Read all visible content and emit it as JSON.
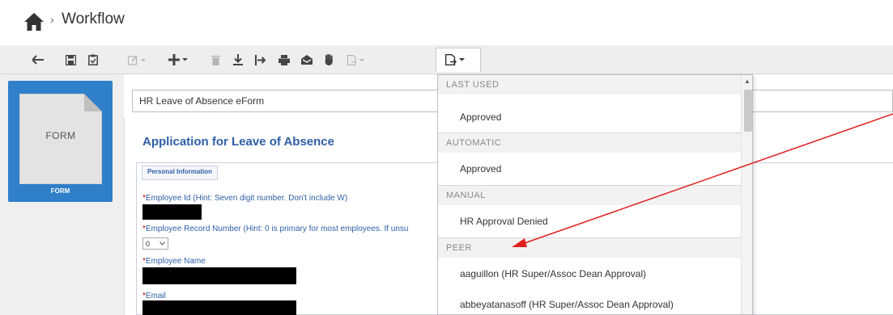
{
  "header": {
    "separator": "›",
    "title": "Workflow"
  },
  "form": {
    "title_value": "HR Leave of Absence eForm",
    "app_title": "Application for Leave of Absence",
    "section_legend": "Personal Information",
    "fields": {
      "employee_id_label": "Employee Id (Hint: Seven digit number. Don't include W)",
      "record_number_label": "Employee Record Number (Hint: 0 is primary for most employees. If unsu",
      "record_number_value": "0",
      "employee_name_label": "Employee Name",
      "email_label": "Email",
      "required_mark": "*"
    }
  },
  "thumbnail": {
    "doc_label": "FORM",
    "caption": "FORM"
  },
  "dropdown": {
    "sections": [
      {
        "header": "LAST USED",
        "items": [
          "Approved"
        ]
      },
      {
        "header": "AUTOMATIC",
        "items": [
          "Approved"
        ]
      },
      {
        "header": "MANUAL",
        "items": [
          "HR Approval Denied"
        ]
      },
      {
        "header": "PEER",
        "items": [
          "aaguillon (HR Super/Assoc Dean Approval)",
          "abbeyatanasoff (HR Super/Assoc Dean Approval)"
        ]
      }
    ]
  },
  "colors": {
    "accent_blue": "#2f7fc9",
    "title_blue": "#2e5fa6",
    "required_red": "#c00000",
    "annotation_red": "#e02020",
    "toolbar_bg": "#eeeeee"
  },
  "icons": {
    "home": "home-icon",
    "toolbar": [
      "back-icon",
      "save-icon",
      "clipboard-icon",
      "edit-icon",
      "add-icon",
      "delete-icon",
      "download-icon",
      "export-icon",
      "print-icon",
      "inbox-icon",
      "hand-icon",
      "route-icon",
      "route-active-icon"
    ]
  }
}
